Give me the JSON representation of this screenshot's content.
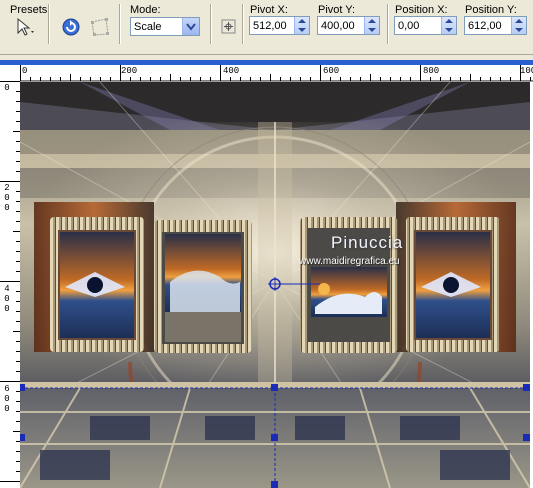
{
  "toolbar": {
    "presets_label": "Presets:",
    "mode_label": "Mode:",
    "mode_value": "Scale",
    "pivot_x_label": "Pivot X:",
    "pivot_x_value": "512,00",
    "pivot_y_label": "Pivot Y:",
    "pivot_y_value": "400,00",
    "position_x_label": "Position X:",
    "position_x_value": "0,00",
    "position_y_label": "Position Y:",
    "position_y_value": "612,00"
  },
  "ruler": {
    "horizontal_labels": [
      "0",
      "200",
      "400",
      "600",
      "800",
      "100"
    ],
    "vertical_labels": [
      "0",
      "200",
      "400",
      "600"
    ]
  },
  "canvas": {
    "watermark_title": "Pinuccia",
    "watermark_url": "www.maidiregrafica.eu"
  },
  "colors": {
    "window_title_bar": "#2b5fd0",
    "toolbar_bg": "#ece9d8",
    "handle_color": "#1a2bb8"
  },
  "icons": [
    "preset-arrow-icon",
    "reset-icon",
    "deform-icon",
    "pivot-icon",
    "spin-arrows-icon"
  ]
}
